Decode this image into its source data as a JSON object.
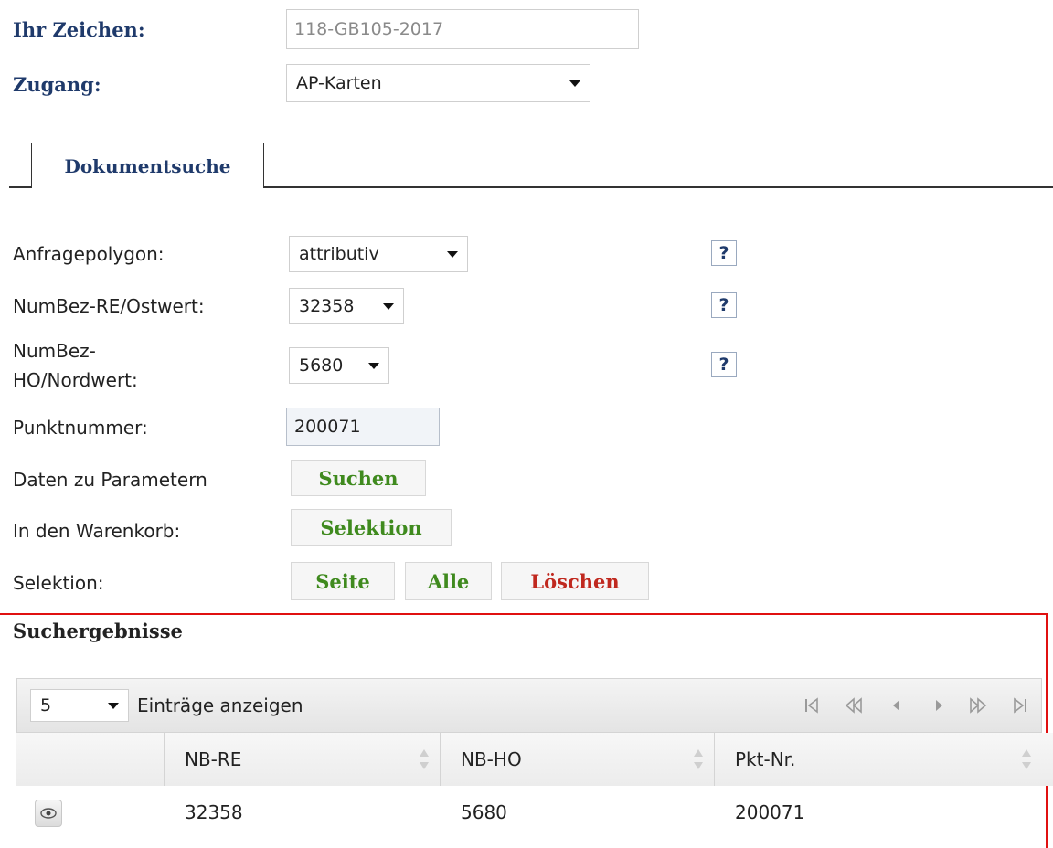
{
  "header": {
    "ihr_zeichen_label": "Ihr Zeichen:",
    "ihr_zeichen_value": "118-GB105-2017",
    "zugang_label": "Zugang:",
    "zugang_value": "AP-Karten"
  },
  "tabs": [
    {
      "label": "Dokumentsuche"
    }
  ],
  "form": {
    "anfragepolygon_label": "Anfragepolygon:",
    "anfragepolygon_value": "attributiv",
    "re_label": "NumBez-RE/Ostwert:",
    "re_value": "32358",
    "ho_label_line1": "NumBez-",
    "ho_label_line2": "HO/Nordwert:",
    "ho_value": "5680",
    "punkt_label": "Punktnummer:",
    "punkt_value": "200071",
    "daten_label": "Daten zu Parametern",
    "suchen_label": "Suchen",
    "warenkorb_label": "In den Warenkorb:",
    "selektion_btn_label": "Selektion",
    "selektion_label": "Selektion:",
    "seite_label": "Seite",
    "alle_label": "Alle",
    "loeschen_label": "Löschen",
    "help_label": "?"
  },
  "results": {
    "title": "Suchergebnisse",
    "page_size": "5",
    "entries_label": "Einträge anzeigen",
    "columns": [
      "NB-RE",
      "NB-HO",
      "Pkt-Nr."
    ],
    "rows": [
      {
        "nb_re": "32358",
        "nb_ho": "5680",
        "pkt_nr": "200071"
      }
    ]
  },
  "colors": {
    "label_blue": "#1f3a6b",
    "button_green": "#3f8a1e",
    "button_red": "#c0281e",
    "highlight_box": "#e01010"
  },
  "icons": [
    "first-page-icon",
    "prev-fast-icon",
    "prev-page-icon",
    "next-page-icon",
    "next-fast-icon",
    "last-page-icon",
    "eye-icon",
    "caret-down-icon"
  ]
}
